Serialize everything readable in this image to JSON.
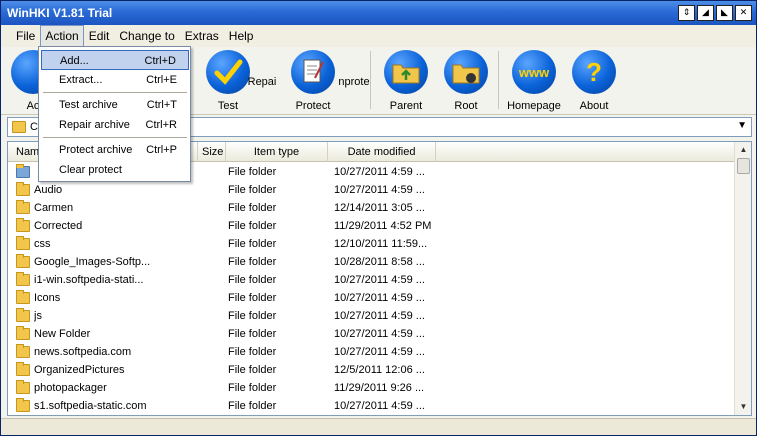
{
  "title": "WinHKI V1.81 Trial",
  "title_buttons": [
    "⇕",
    "◢",
    "◣",
    "✕"
  ],
  "menu": [
    "File",
    "Action",
    "Edit",
    "Change to",
    "Extras",
    "Help"
  ],
  "toolbar": {
    "add_label": "Ac",
    "test_label": "Test",
    "repair_label": "Repai",
    "protect_label": "Protect",
    "unprotect_label": "nprote",
    "parent_label": "Parent",
    "root_label": "Root",
    "homepage_label": "Homepage",
    "homepage_icon_text": "www",
    "about_label": "About",
    "about_icon_text": "?"
  },
  "path": "C",
  "columns": {
    "name": "Nam",
    "size": "Size",
    "type": "Item type",
    "date": "Date modified"
  },
  "rows": [
    {
      "name": "",
      "type": "File folder",
      "date": "10/27/2011 4:59 ..."
    },
    {
      "name": "Audio",
      "type": "File folder",
      "date": "10/27/2011 4:59 ..."
    },
    {
      "name": "Carmen",
      "type": "File folder",
      "date": "12/14/2011 3:05 ..."
    },
    {
      "name": "Corrected",
      "type": "File folder",
      "date": "11/29/2011 4:52 PM"
    },
    {
      "name": "css",
      "type": "File folder",
      "date": "12/10/2011 11:59..."
    },
    {
      "name": "Google_Images-Softp...",
      "type": "File folder",
      "date": "10/28/2011 8:58 ..."
    },
    {
      "name": "i1-win.softpedia-stati...",
      "type": "File folder",
      "date": "10/27/2011 4:59 ..."
    },
    {
      "name": "Icons",
      "type": "File folder",
      "date": "10/27/2011 4:59 ..."
    },
    {
      "name": "js",
      "type": "File folder",
      "date": "10/27/2011 4:59 ..."
    },
    {
      "name": "New Folder",
      "type": "File folder",
      "date": "10/27/2011 4:59 ..."
    },
    {
      "name": "news.softpedia.com",
      "type": "File folder",
      "date": "10/27/2011 4:59 ..."
    },
    {
      "name": "OrganizedPictures",
      "type": "File folder",
      "date": "12/5/2011 12:06 ..."
    },
    {
      "name": "photopackager",
      "type": "File folder",
      "date": "11/29/2011 9:26 ..."
    },
    {
      "name": "s1.softpedia-static.com",
      "type": "File folder",
      "date": "10/27/2011 4:59 ..."
    }
  ],
  "dropdown": [
    {
      "label": "Add...",
      "shortcut": "Ctrl+D"
    },
    {
      "label": "Extract...",
      "shortcut": "Ctrl+E"
    },
    {
      "label": "Test archive",
      "shortcut": "Ctrl+T"
    },
    {
      "label": "Repair archive",
      "shortcut": "Ctrl+R"
    },
    {
      "label": "Protect archive",
      "shortcut": "Ctrl+P"
    },
    {
      "label": "Clear protect",
      "shortcut": ""
    }
  ],
  "icons": {
    "test": "checkmark-icon",
    "protect": "document-icon",
    "parent": "folder-up-icon",
    "root": "folder-root-icon",
    "homepage": "globe-icon",
    "about": "help-icon"
  },
  "colors": {
    "titlebar": "#2a6ad6",
    "menu_highlight": "#c1d2ee",
    "folder": "#f2c54b"
  }
}
